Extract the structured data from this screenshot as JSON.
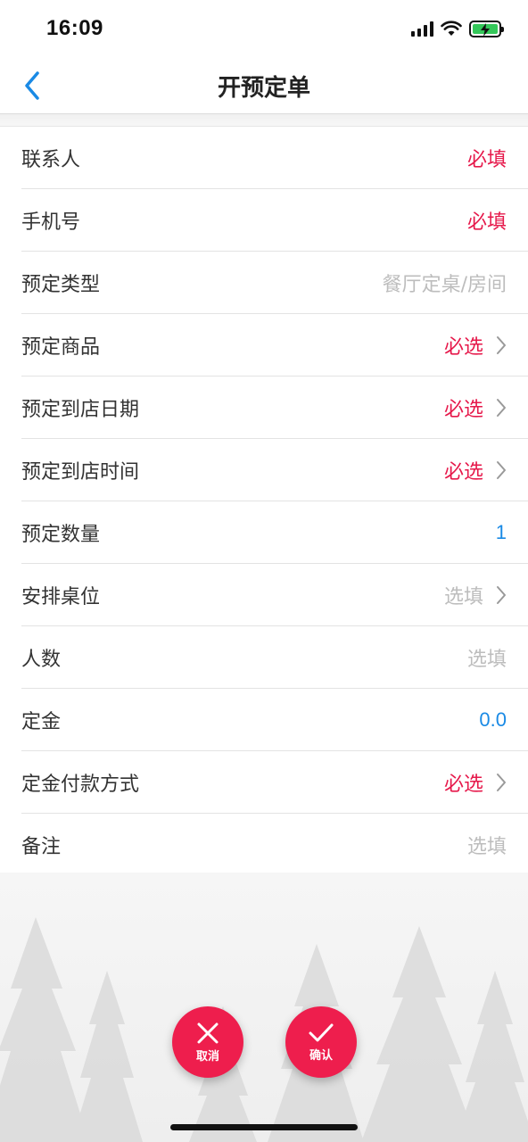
{
  "status_bar": {
    "time": "16:09",
    "icons": [
      "signal-icon",
      "wifi-icon",
      "battery-charging-icon"
    ],
    "battery_color": "#34c759"
  },
  "nav": {
    "title": "开预定单",
    "back_icon": "chevron-left-icon",
    "accent": "#1a8ae5"
  },
  "colors": {
    "required": "#e6194b",
    "hint": "#bdbdbd",
    "value": "#1a8ae5",
    "fab": "#ee1e4d"
  },
  "form": {
    "rows": [
      {
        "label": "联系人",
        "value": "必填",
        "kind": "required",
        "chevron": false
      },
      {
        "label": "手机号",
        "value": "必填",
        "kind": "required",
        "chevron": false
      },
      {
        "label": "预定类型",
        "value": "餐厅定桌/房间",
        "kind": "hint",
        "chevron": false
      },
      {
        "label": "预定商品",
        "value": "必选",
        "kind": "required",
        "chevron": true
      },
      {
        "label": "预定到店日期",
        "value": "必选",
        "kind": "required",
        "chevron": true
      },
      {
        "label": "预定到店时间",
        "value": "必选",
        "kind": "required",
        "chevron": true
      },
      {
        "label": "预定数量",
        "value": "1",
        "kind": "value",
        "chevron": false
      },
      {
        "label": "安排桌位",
        "value": "选填",
        "kind": "hint",
        "chevron": true
      },
      {
        "label": "人数",
        "value": "选填",
        "kind": "hint",
        "chevron": false
      },
      {
        "label": "定金",
        "value": "0.0",
        "kind": "value",
        "chevron": false
      },
      {
        "label": "定金付款方式",
        "value": "必选",
        "kind": "required",
        "chevron": true
      },
      {
        "label": "备注",
        "value": "选填",
        "kind": "hint",
        "chevron": false
      }
    ]
  },
  "actions": {
    "cancel_label": "取消",
    "cancel_icon": "close-icon",
    "confirm_label": "确认",
    "confirm_icon": "check-icon"
  }
}
